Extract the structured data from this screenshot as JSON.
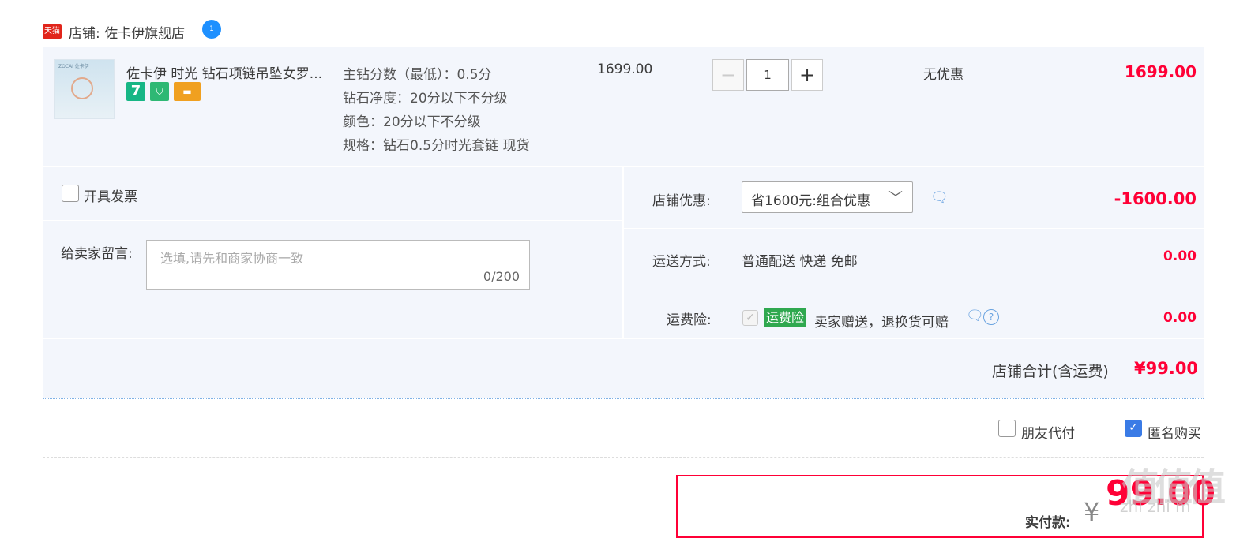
{
  "shop": {
    "badge": "天猫",
    "label": "店铺: 佐卡伊旗舰店",
    "ww_icon": "wangwang-chat-icon"
  },
  "item": {
    "thumb_brand": "ZOCAI 佐卡伊",
    "title": "佐卡伊 时光 钻石项链吊坠女罗...",
    "service_icons": [
      "seven-day-return-icon",
      "shield-guarantee-icon",
      "card-payment-icon"
    ],
    "seven_label": "7",
    "props": [
      "主钻分数（最低）：0.5分",
      "钻石净度：20分以下不分级",
      "颜色：20分以下不分级",
      "规格：钻石0.5分时光套链 现货"
    ],
    "unit_price": "1699.00",
    "quantity": "1",
    "minus": "−",
    "plus": "+",
    "promo": "无优惠",
    "subtotal": "1699.00"
  },
  "invoice": {
    "label": "开具发票",
    "checked": false
  },
  "message": {
    "label": "给卖家留言:",
    "placeholder": "选填,请先和商家协商一致",
    "counter": "0/200"
  },
  "shop_discount": {
    "label": "店铺优惠:",
    "selected": "省1600元:组合优惠",
    "amount": "-1600.00"
  },
  "shipping": {
    "label": "运送方式:",
    "value": "普通配送 快递 免邮",
    "amount": "0.00"
  },
  "insurance": {
    "label": "运费险:",
    "badge": "运费险",
    "text": "卖家赠送，退换货可赔",
    "amount": "0.00",
    "help": "?"
  },
  "shop_total": {
    "label": "店铺合计(含运费)",
    "amount": "¥99.00"
  },
  "options": {
    "friend_pay": "朋友代付",
    "anonymous": "匿名购买",
    "friend_pay_checked": false,
    "anonymous_checked": true
  },
  "payment": {
    "label": "实付款:",
    "currency": "¥",
    "amount": "99.00"
  },
  "watermark": {
    "logo": "值值值",
    "sub": "zhi zhi m"
  },
  "colors": {
    "accent_red": "#ff0036",
    "panel_bg": "#f3f6fc",
    "checkbox_blue": "#3a7be6",
    "insurance_green": "#2fa84f"
  }
}
